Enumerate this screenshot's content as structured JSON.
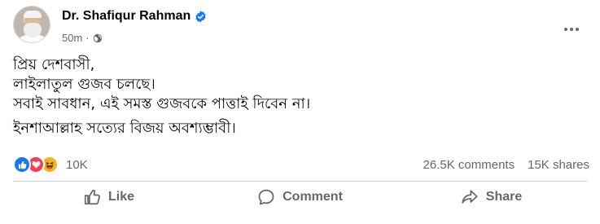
{
  "post": {
    "author": "Dr. Shafiqur Rahman",
    "time": "50m",
    "separator": "·",
    "body": {
      "line1": "প্রিয় দেশবাসী,",
      "line2": "লাইলাতুল গুজব চলছে।",
      "line3": "সবাই সাবধান, এই সমস্ত গুজবকে পাত্তাই দিবেন না।",
      "line4": "ইনশাআল্লাহ সত্যের বিজয় অবশ্যম্ভাবী।"
    },
    "reactions": {
      "types": [
        "like-icon",
        "love-icon",
        "haha-icon"
      ],
      "count": "10K"
    },
    "stats": {
      "comments": "26.5K comments",
      "shares": "15K shares"
    },
    "actions": {
      "like": "Like",
      "comment": "Comment",
      "share": "Share"
    }
  },
  "colors": {
    "brand_blue": "#1877f2",
    "love_red": "#f33e58",
    "haha_yellow": "#f7b125",
    "secondary_text": "#65676b"
  }
}
